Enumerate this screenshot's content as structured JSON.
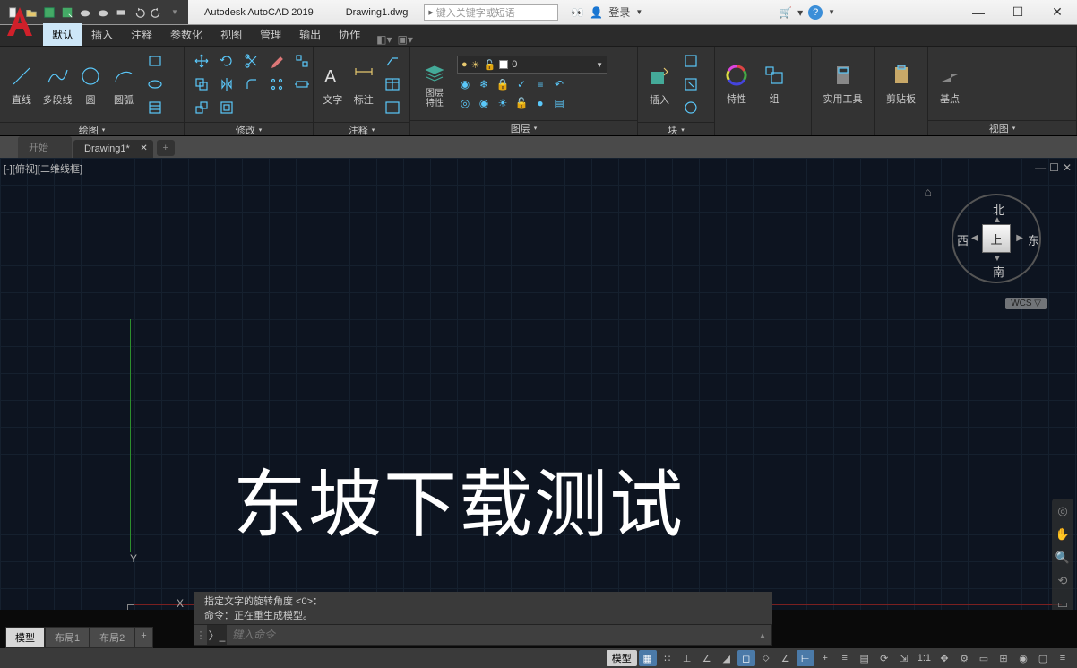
{
  "title": {
    "app": "Autodesk AutoCAD 2019",
    "file": "Drawing1.dwg"
  },
  "search": {
    "placeholder": "键入关键字或短语"
  },
  "login": {
    "label": "登录"
  },
  "ribbonTabs": [
    "默认",
    "插入",
    "注释",
    "参数化",
    "视图",
    "管理",
    "输出",
    "协作"
  ],
  "panels": {
    "draw": {
      "title": "绘图",
      "line": "直线",
      "pline": "多段线",
      "circle": "圆",
      "arc": "圆弧"
    },
    "modify": {
      "title": "修改"
    },
    "annotate": {
      "title": "注释",
      "text": "文字",
      "dim": "标注"
    },
    "layers": {
      "title": "图层",
      "props": "图层\n特性",
      "current": "0"
    },
    "blocks": {
      "title": "块",
      "insert": "插入"
    },
    "props": {
      "title": "特性",
      "group": "组"
    },
    "utils": {
      "title": "实用工具"
    },
    "clip": {
      "title": "剪贴板"
    },
    "view": {
      "title": "视图",
      "base": "基点"
    }
  },
  "fileTabs": {
    "start": "开始",
    "drawing": "Drawing1*"
  },
  "viewport": {
    "label": "[-][俯视][二维线框]"
  },
  "ucs": {
    "x": "X",
    "y": "Y"
  },
  "canvasText": "东坡下载测试",
  "viewcube": {
    "face": "上",
    "n": "北",
    "s": "南",
    "e": "东",
    "w": "西",
    "wcs": "WCS ▽"
  },
  "cmd": {
    "hist1": "指定文字的旋转角度 <0>：",
    "hist2": "命令：正在重生成模型。",
    "placeholder": "键入命令"
  },
  "bottomTabs": {
    "model": "模型",
    "layout1": "布局1",
    "layout2": "布局2"
  },
  "status": {
    "model": "模型",
    "scale": "1:1"
  }
}
